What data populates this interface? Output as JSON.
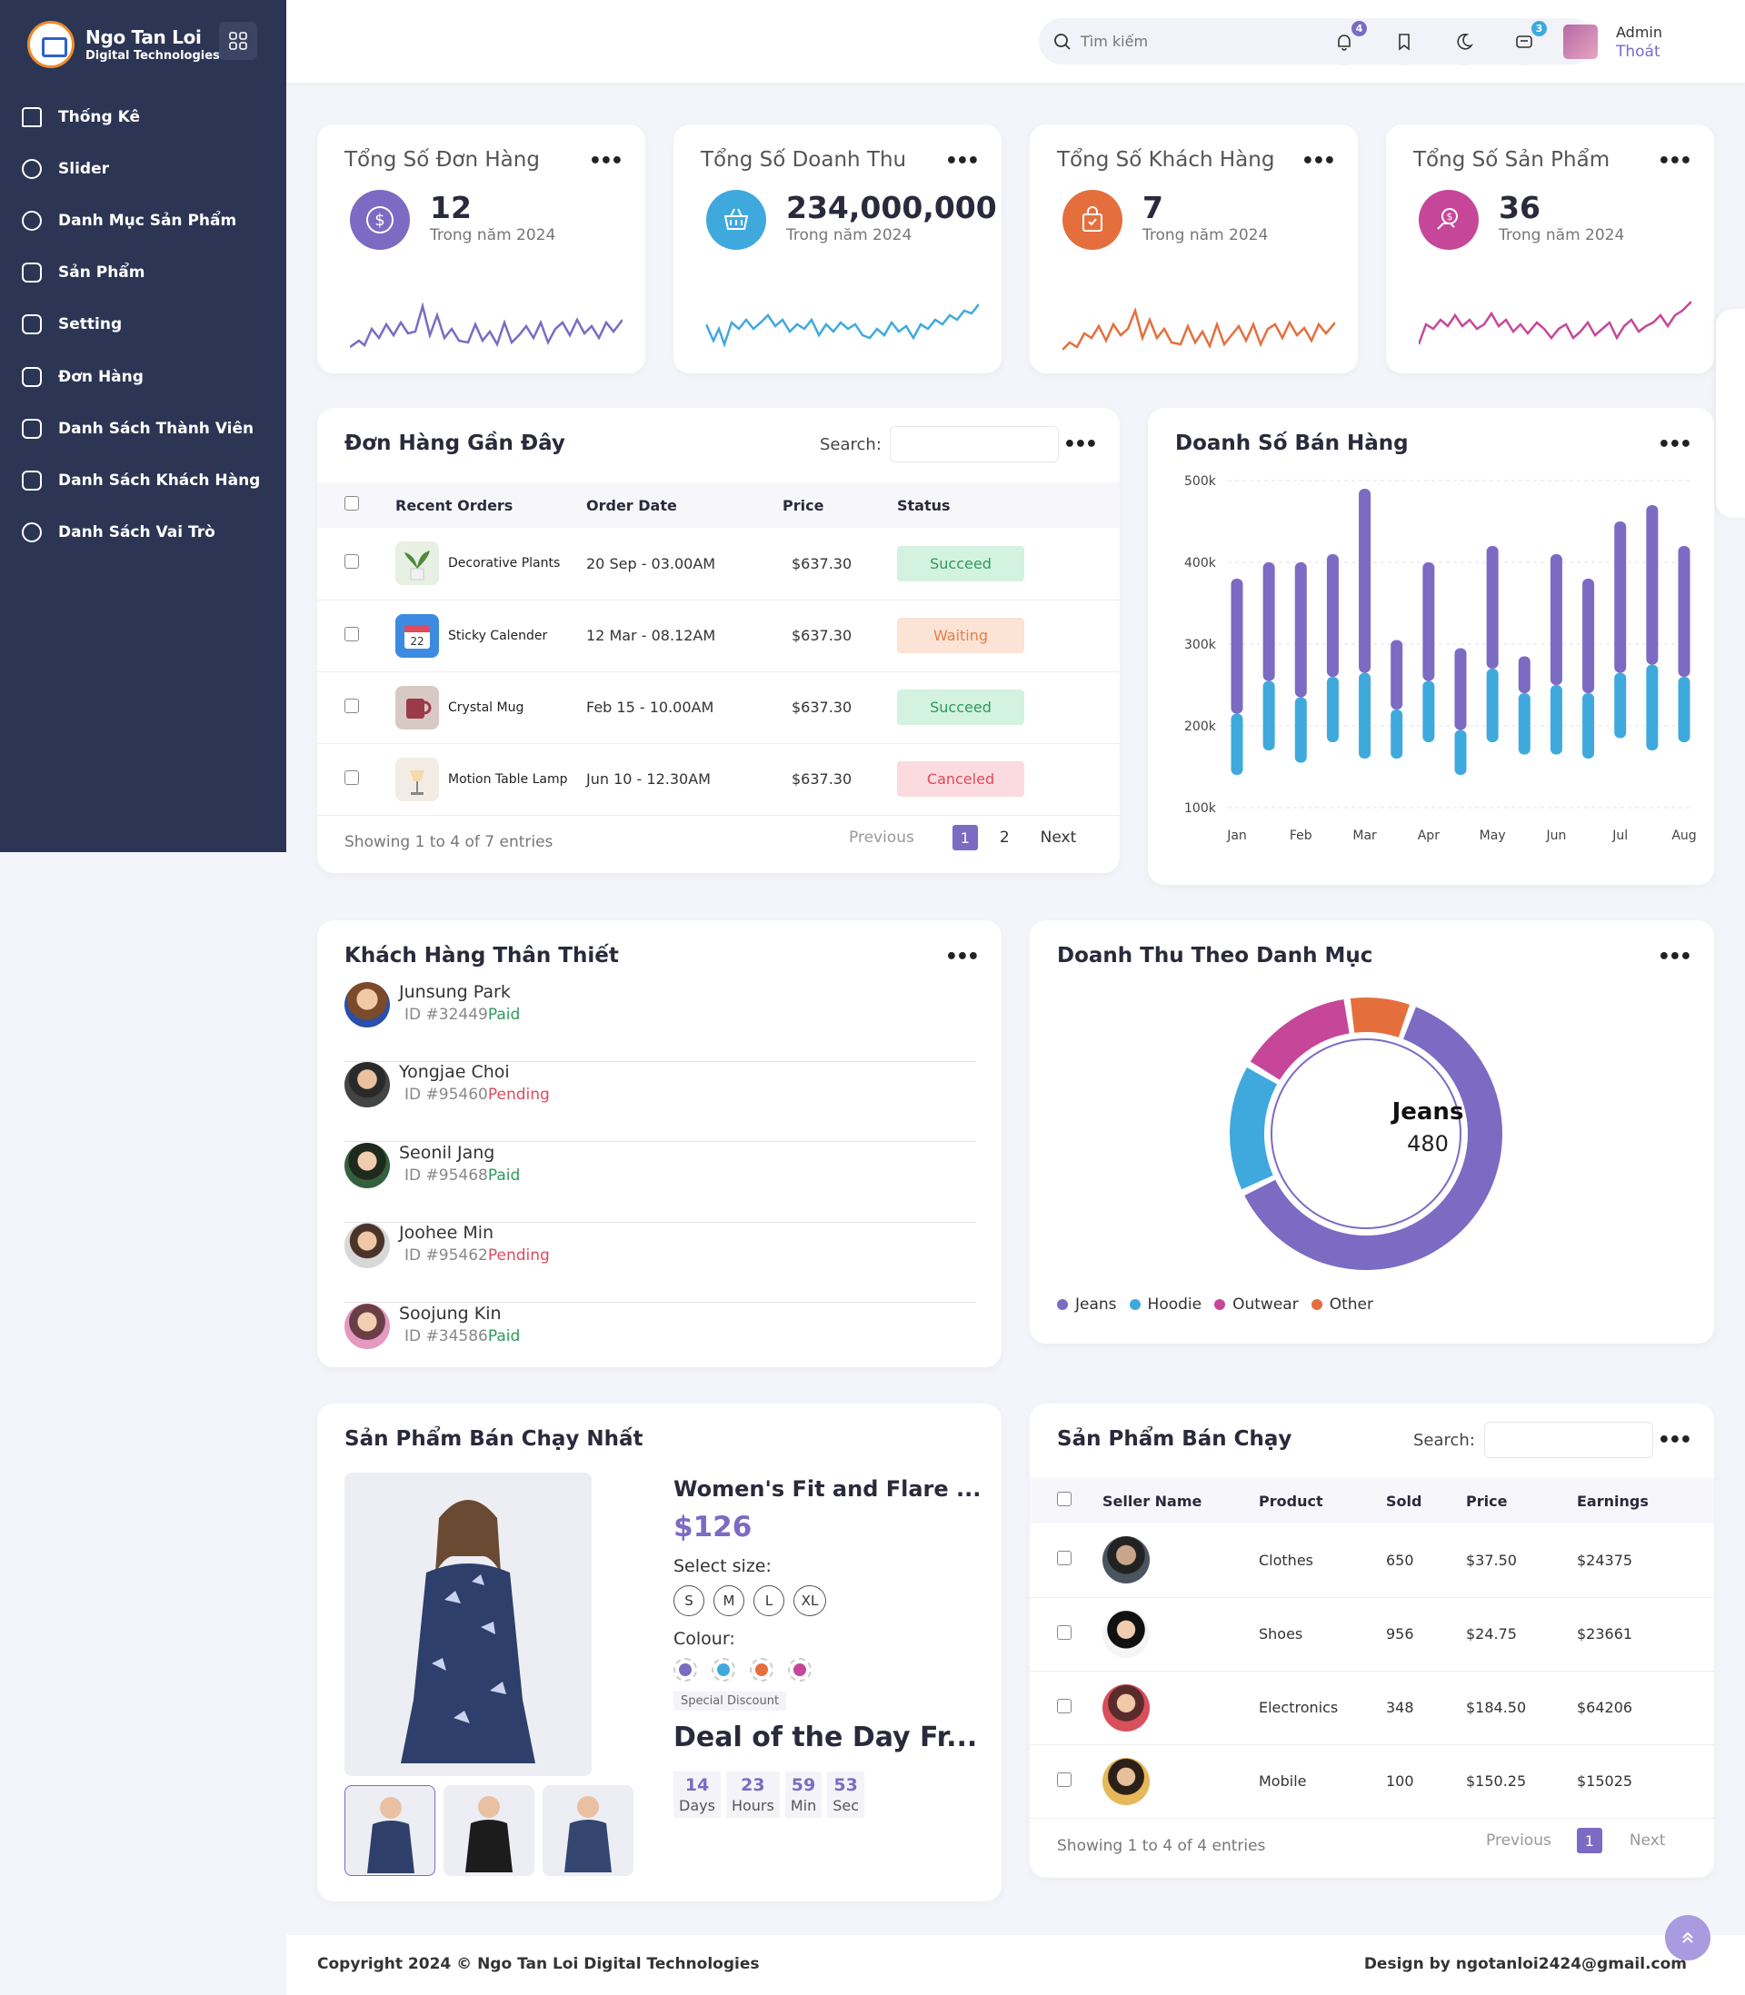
{
  "brand": {
    "name": "Ngo Tan Loi",
    "sub": "Digital Technologies"
  },
  "sidebar": {
    "items": [
      {
        "label": "Thống Kê"
      },
      {
        "label": "Slider"
      },
      {
        "label": "Danh Mục Sản Phẩm"
      },
      {
        "label": "Sản Phẩm"
      },
      {
        "label": "Setting"
      },
      {
        "label": "Đơn Hàng"
      },
      {
        "label": "Danh Sách Thành Viên"
      },
      {
        "label": "Danh Sách Khách Hàng"
      },
      {
        "label": "Danh Sách Vai Trò"
      }
    ]
  },
  "topbar": {
    "search_placeholder": "Tìm kiếm",
    "notif_count": "4",
    "msg_count": "3",
    "user_name": "Admin",
    "logout": "Thoát"
  },
  "stats": [
    {
      "title": "Tổng Số Đơn Hàng",
      "value": "12",
      "sub": "Trong năm 2024",
      "color": "#7b6bc3",
      "icon": "dollar-icon"
    },
    {
      "title": "Tổng Số Doanh Thu",
      "value": "234,000,000",
      "sub": "Trong năm 2024",
      "color": "#3fa9de",
      "icon": "basket-icon"
    },
    {
      "title": "Tổng Số Khách Hàng",
      "value": "7",
      "sub": "Trong năm 2024",
      "color": "#e46f3d",
      "icon": "bag-icon"
    },
    {
      "title": "Tổng Số Sản Phẩm",
      "value": "36",
      "sub": "Trong năm 2024",
      "color": "#c6479a",
      "icon": "hand-dollar-icon"
    }
  ],
  "recent_orders": {
    "title": "Đơn Hàng Gần Đây",
    "search_label": "Search:",
    "headers": [
      "Recent Orders",
      "Order Date",
      "Price",
      "Status"
    ],
    "rows": [
      {
        "product": "Decorative Plants",
        "date": "20 Sep - 03.00AM",
        "price": "$637.30",
        "status": "Succeed",
        "kind": "green"
      },
      {
        "product": "Sticky Calender",
        "date": "12 Mar - 08.12AM",
        "price": "$637.30",
        "status": "Waiting",
        "kind": "orange"
      },
      {
        "product": "Crystal Mug",
        "date": "Feb 15 - 10.00AM",
        "price": "$637.30",
        "status": "Succeed",
        "kind": "green"
      },
      {
        "product": "Motion Table Lamp",
        "date": "Jun 10 - 12.30AM",
        "price": "$637.30",
        "status": "Canceled",
        "kind": "red"
      }
    ],
    "info": "Showing 1 to 4 of 7 entries",
    "prev": "Previous",
    "page1": "1",
    "page2": "2",
    "next": "Next"
  },
  "sales_chart": {
    "title": "Doanh Số Bán Hàng"
  },
  "chart_data": [
    {
      "type": "bar",
      "title": "Doanh Số Bán Hàng",
      "stacked": true,
      "x_ticks": [
        "Jan",
        "Feb",
        "Mar",
        "Apr",
        "May",
        "Jun",
        "Jul",
        "Aug"
      ],
      "y_ticks": [
        "500k",
        "400k",
        "300k",
        "200k",
        "100k"
      ],
      "ylim": [
        100000,
        500000
      ],
      "colors": [
        "#3fa9de",
        "#7b6bc3"
      ],
      "bars": [
        {
          "low": 140000,
          "mid": 215000,
          "high": 380000
        },
        {
          "low": 170000,
          "mid": 255000,
          "high": 400000
        },
        {
          "low": 155000,
          "mid": 235000,
          "high": 400000
        },
        {
          "low": 180000,
          "mid": 260000,
          "high": 410000
        },
        {
          "low": 160000,
          "mid": 265000,
          "high": 490000
        },
        {
          "low": 160000,
          "mid": 220000,
          "high": 305000
        },
        {
          "low": 180000,
          "mid": 255000,
          "high": 400000
        },
        {
          "low": 140000,
          "mid": 195000,
          "high": 295000
        },
        {
          "low": 180000,
          "mid": 270000,
          "high": 420000
        },
        {
          "low": 165000,
          "mid": 240000,
          "high": 285000
        },
        {
          "low": 165000,
          "mid": 250000,
          "high": 410000
        },
        {
          "low": 160000,
          "mid": 240000,
          "high": 380000
        },
        {
          "low": 185000,
          "mid": 265000,
          "high": 450000
        },
        {
          "low": 170000,
          "mid": 275000,
          "high": 470000
        },
        {
          "low": 180000,
          "mid": 260000,
          "high": 420000
        }
      ]
    },
    {
      "type": "pie",
      "title": "Doanh Thu Theo Danh Mục",
      "slices": [
        {
          "label": "Jeans",
          "value": 480,
          "color": "#7b6bc3"
        },
        {
          "label": "Hoodie",
          "value": 120,
          "color": "#3fa9de"
        },
        {
          "label": "Outwear",
          "value": 110,
          "color": "#c6479a"
        },
        {
          "label": "Other",
          "value": 60,
          "color": "#e46f3d"
        }
      ]
    }
  ],
  "loyal_customers": {
    "title": "Khách Hàng Thân Thiết",
    "items": [
      {
        "name": "Junsung Park",
        "id": "ID #32449",
        "status": "Paid",
        "kind": "paid"
      },
      {
        "name": "Yongjae Choi",
        "id": "ID #95460",
        "status": "Pending",
        "kind": "pending"
      },
      {
        "name": "Seonil Jang",
        "id": "ID #95468",
        "status": "Paid",
        "kind": "paid"
      },
      {
        "name": "Joohee Min",
        "id": "ID #95462",
        "status": "Pending",
        "kind": "pending"
      },
      {
        "name": "Soojung Kin",
        "id": "ID #34586",
        "status": "Paid",
        "kind": "paid"
      }
    ]
  },
  "category_revenue": {
    "title": "Doanh Thu Theo Danh Mục",
    "center_label": "Jeans",
    "center_value": "480",
    "legend": [
      "Jeans",
      "Hoodie",
      "Outwear",
      "Other"
    ]
  },
  "best_product": {
    "title": "Sản Phẩm Bán Chạy Nhất",
    "name": "Women's Fit and Flare ...",
    "price": "$126",
    "size_label": "Select size:",
    "sizes": [
      "S",
      "M",
      "L",
      "XL"
    ],
    "colour_label": "Colour:",
    "colours": [
      "#7b6bc3",
      "#3fa9de",
      "#e46f3d",
      "#c6479a"
    ],
    "discount": "Special Discount",
    "deal": "Deal of the Day Fr...",
    "countdown": [
      {
        "num": "14",
        "label": "Days"
      },
      {
        "num": "23",
        "label": "Hours"
      },
      {
        "num": "59",
        "label": "Min"
      },
      {
        "num": "53",
        "label": "Sec"
      }
    ]
  },
  "top_products": {
    "title": "Sản Phẩm Bán Chạy",
    "search_label": "Search:",
    "headers": [
      "Seller Name",
      "Product",
      "Sold",
      "Price",
      "Earnings"
    ],
    "rows": [
      {
        "product": "Clothes",
        "sold": "650",
        "price": "$37.50",
        "earnings": "$24375"
      },
      {
        "product": "Shoes",
        "sold": "956",
        "price": "$24.75",
        "earnings": "$23661"
      },
      {
        "product": "Electronics",
        "sold": "348",
        "price": "$184.50",
        "earnings": "$64206"
      },
      {
        "product": "Mobile",
        "sold": "100",
        "price": "$150.25",
        "earnings": "$15025"
      }
    ],
    "info": "Showing 1 to 4 of 4 entries",
    "prev": "Previous",
    "page1": "1",
    "next": "Next"
  },
  "footer": {
    "copyright": "Copyright 2024 © Ngo Tan Loi Digital Technologies",
    "design": "Design by ngotanloi2424@gmail.com"
  }
}
